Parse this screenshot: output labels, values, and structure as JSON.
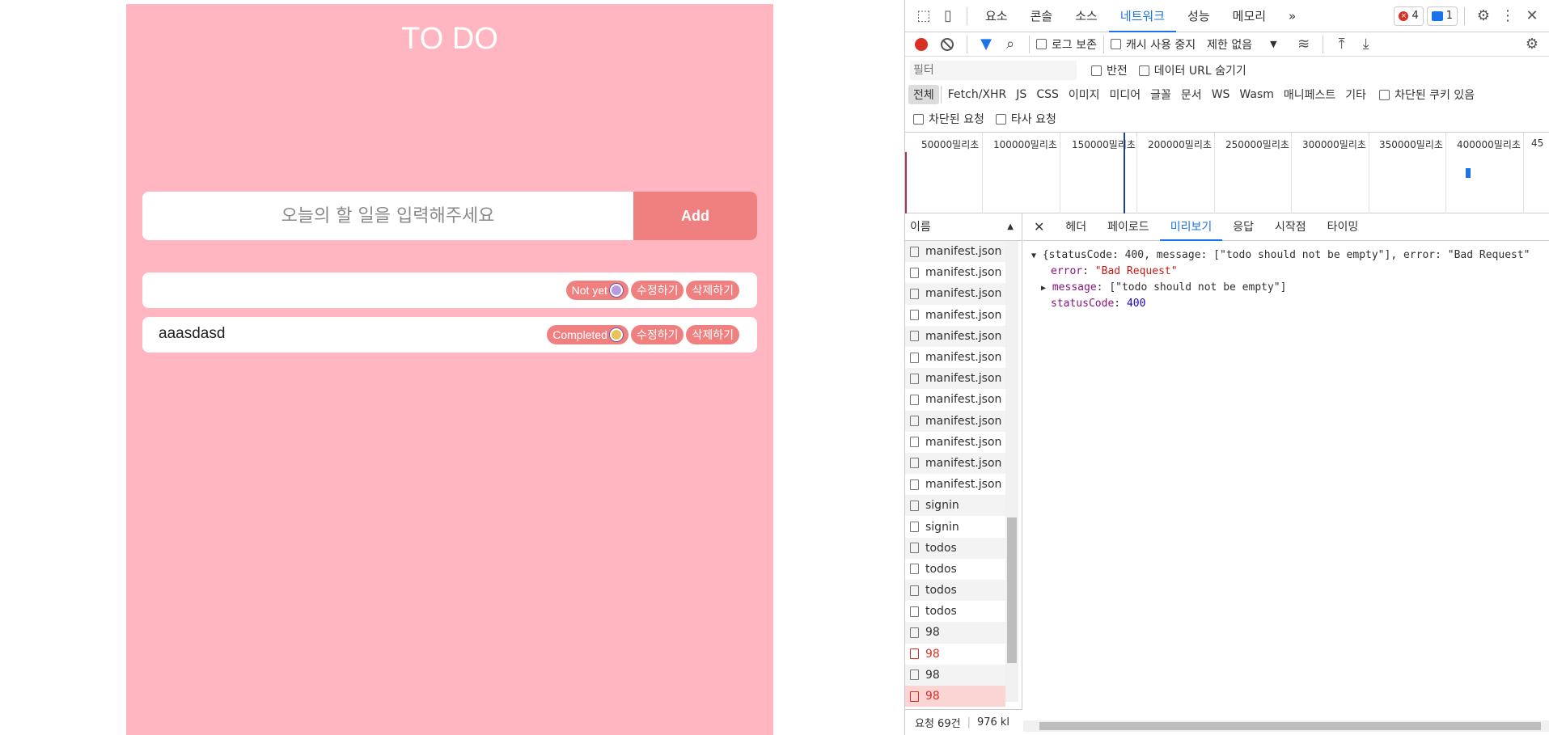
{
  "app": {
    "title": "TO DO",
    "input_placeholder": "오늘의 할 일을 입력해주세요",
    "add_label": "Add",
    "todos": [
      {
        "text": "",
        "status": "Not yet",
        "edit_label": "수정하기",
        "delete_label": "삭제하기"
      },
      {
        "text": "aaasdasd",
        "status": "Completed",
        "edit_label": "수정하기",
        "delete_label": "삭제하기"
      }
    ],
    "colors": {
      "panel": "#ffb6c1",
      "accent": "#f08080"
    }
  },
  "devtools": {
    "tabs": [
      "요소",
      "콘솔",
      "소스",
      "네트워크",
      "성능",
      "메모리"
    ],
    "active_tab": "네트워크",
    "more": "»",
    "error_count": "4",
    "message_count": "1",
    "toolbar": {
      "preserve_log": "로그 보존",
      "disable_cache": "캐시 사용 중지",
      "throttle": "제한 없음"
    },
    "filter": {
      "placeholder": "필터",
      "invert": "반전",
      "hide_data_urls": "데이터 URL 숨기기"
    },
    "types": [
      "전체",
      "Fetch/XHR",
      "JS",
      "CSS",
      "이미지",
      "미디어",
      "글꼴",
      "문서",
      "WS",
      "Wasm",
      "매니페스트",
      "기타"
    ],
    "blocked_cookies": "차단된 쿠키 있음",
    "blocked_requests": "차단된 요청",
    "third_party": "타사 요청",
    "timeline_labels": [
      "50000밀리초",
      "100000밀리초",
      "150000밀리초",
      "200000밀리초",
      "250000밀리초",
      "300000밀리초",
      "350000밀리초",
      "400000밀리초",
      "45"
    ],
    "name_header": "이름",
    "requests": [
      {
        "name": "manifest.json",
        "error": false
      },
      {
        "name": "manifest.json",
        "error": false
      },
      {
        "name": "manifest.json",
        "error": false
      },
      {
        "name": "manifest.json",
        "error": false
      },
      {
        "name": "manifest.json",
        "error": false
      },
      {
        "name": "manifest.json",
        "error": false
      },
      {
        "name": "manifest.json",
        "error": false
      },
      {
        "name": "manifest.json",
        "error": false
      },
      {
        "name": "manifest.json",
        "error": false
      },
      {
        "name": "manifest.json",
        "error": false
      },
      {
        "name": "manifest.json",
        "error": false
      },
      {
        "name": "manifest.json",
        "error": false
      },
      {
        "name": "signin",
        "error": false
      },
      {
        "name": "signin",
        "error": false
      },
      {
        "name": "todos",
        "error": false
      },
      {
        "name": "todos",
        "error": false
      },
      {
        "name": "todos",
        "error": false
      },
      {
        "name": "todos",
        "error": false
      },
      {
        "name": "98",
        "error": false
      },
      {
        "name": "98",
        "error": true
      },
      {
        "name": "98",
        "error": false
      },
      {
        "name": "98",
        "error": true,
        "selected": true
      }
    ],
    "status_requests": "요청 69건",
    "status_size": "976 kl",
    "preview_tabs": [
      "헤더",
      "페이로드",
      "미리보기",
      "응답",
      "시작점",
      "타이밍"
    ],
    "active_preview_tab": "미리보기",
    "json": {
      "summary": "{statusCode: 400, message: [\"todo should not be empty\"], error: \"Bad Request\"",
      "error_key": "error",
      "error_val": "\"Bad Request\"",
      "message_key": "message",
      "message_val": "[\"todo should not be empty\"]",
      "status_key": "statusCode",
      "status_val": "400"
    }
  }
}
